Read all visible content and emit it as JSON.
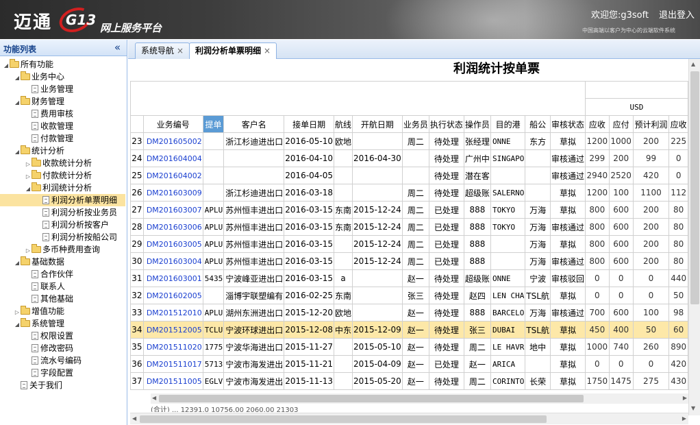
{
  "header": {
    "logo_text": "迈通",
    "logo_badge": "G13",
    "platform": "网上服务平台",
    "welcome": "欢迎您:g3soft",
    "logout": "退出登入",
    "slogan": "中国高端以客户为中心的云端软件系统"
  },
  "sidebar": {
    "title": "功能列表",
    "collapse_icon": "«",
    "items": [
      {
        "label": "所有功能",
        "level": 0,
        "type": "folder",
        "expanded": true
      },
      {
        "label": "业务中心",
        "level": 1,
        "type": "folder",
        "expanded": true
      },
      {
        "label": "业务管理",
        "level": 2,
        "type": "doc"
      },
      {
        "label": "财务管理",
        "level": 1,
        "type": "folder",
        "expanded": true
      },
      {
        "label": "费用审核",
        "level": 2,
        "type": "doc"
      },
      {
        "label": "收款管理",
        "level": 2,
        "type": "doc"
      },
      {
        "label": "付款管理",
        "level": 2,
        "type": "doc"
      },
      {
        "label": "统计分析",
        "level": 1,
        "type": "folder",
        "expanded": true
      },
      {
        "label": "收款统计分析",
        "level": 2,
        "type": "folder",
        "expanded": false
      },
      {
        "label": "付款统计分析",
        "level": 2,
        "type": "folder",
        "expanded": false
      },
      {
        "label": "利润统计分析",
        "level": 2,
        "type": "folder",
        "expanded": true
      },
      {
        "label": "利润分析单票明细",
        "level": 3,
        "type": "doc",
        "selected": true
      },
      {
        "label": "利润分析按业务员",
        "level": 3,
        "type": "doc"
      },
      {
        "label": "利润分析按客户",
        "level": 3,
        "type": "doc"
      },
      {
        "label": "利润分析按船公司",
        "level": 3,
        "type": "doc"
      },
      {
        "label": "多币种费用查询",
        "level": 2,
        "type": "folder",
        "expanded": false
      },
      {
        "label": "基础数据",
        "level": 1,
        "type": "folder",
        "expanded": true
      },
      {
        "label": "合作伙伴",
        "level": 2,
        "type": "doc"
      },
      {
        "label": "联系人",
        "level": 2,
        "type": "doc"
      },
      {
        "label": "其他基础",
        "level": 2,
        "type": "doc"
      },
      {
        "label": "增值功能",
        "level": 1,
        "type": "folder",
        "expanded": false
      },
      {
        "label": "系统管理",
        "level": 1,
        "type": "folder",
        "expanded": true
      },
      {
        "label": "权限设置",
        "level": 2,
        "type": "doc"
      },
      {
        "label": "修改密码",
        "level": 2,
        "type": "doc"
      },
      {
        "label": "流水号编码",
        "level": 2,
        "type": "doc"
      },
      {
        "label": "字段配置",
        "level": 2,
        "type": "doc"
      },
      {
        "label": "关于我们",
        "level": 1,
        "type": "doc"
      }
    ]
  },
  "tabs": [
    {
      "label": "系统导航",
      "close": "×",
      "active": false
    },
    {
      "label": "利润分析单票明细",
      "close": "×",
      "active": true
    }
  ],
  "report": {
    "title": "利润统计按单票",
    "currency": "USD",
    "columns": [
      "",
      "业务编号",
      "提单",
      "客户名",
      "接单日期",
      "航线",
      "开航日期",
      "业务员",
      "执行状态",
      "操作员",
      "目的港",
      "船公",
      "审核状态",
      "应收",
      "应付",
      "预计利润",
      "应收"
    ],
    "rows": [
      [
        "23",
        "DM201605002",
        "",
        "浙江杉迪进出口",
        "2016-05-10",
        "欧地",
        "",
        "周二",
        "待处理",
        "张经理",
        "ONNE",
        "东方",
        "草拟",
        "1200",
        "1000",
        "200",
        "225"
      ],
      [
        "24",
        "DM201604004",
        "",
        "",
        "2016-04-10",
        "",
        "2016-04-30",
        "",
        "待处理",
        "广州中",
        "SINGAPO",
        "",
        "审核通过",
        "299",
        "200",
        "99",
        "0"
      ],
      [
        "25",
        "DM201604002",
        "",
        "",
        "2016-04-05",
        "",
        "",
        "",
        "待处理",
        "潜在客",
        "",
        "",
        "审核通过",
        "2940",
        "2520",
        "420",
        "0"
      ],
      [
        "26",
        "DM201603009",
        "",
        "浙江杉迪进出口",
        "2016-03-18",
        "",
        "",
        "周二",
        "待处理",
        "超级账",
        "SALERNO",
        "",
        "草拟",
        "1200",
        "100",
        "1100",
        "112"
      ],
      [
        "27",
        "DM201603007",
        "APLU",
        "苏州恒丰进出口",
        "2016-03-15",
        "东南",
        "2015-12-24",
        "周二",
        "已处理",
        "888",
        "TOKYO",
        "万海",
        "草拟",
        "800",
        "600",
        "200",
        "80"
      ],
      [
        "28",
        "DM201603006",
        "APLU",
        "苏州恒丰进出口",
        "2016-03-15",
        "东南",
        "2015-12-24",
        "周二",
        "已处理",
        "888",
        "TOKYO",
        "万海",
        "审核通过",
        "800",
        "600",
        "200",
        "80"
      ],
      [
        "29",
        "DM201603005",
        "APLU",
        "苏州恒丰进出口",
        "2016-03-15",
        "",
        "2015-12-24",
        "周二",
        "已处理",
        "888",
        "",
        "万海",
        "草拟",
        "800",
        "600",
        "200",
        "80"
      ],
      [
        "30",
        "DM201603004",
        "APLU",
        "苏州恒丰进出口",
        "2016-03-15",
        "",
        "2015-12-24",
        "周二",
        "已处理",
        "888",
        "",
        "万海",
        "审核通过",
        "800",
        "600",
        "200",
        "80"
      ],
      [
        "31",
        "DM201603001",
        "5435",
        "宁波峰亚进出口",
        "2016-03-15",
        "a",
        "",
        "赵一",
        "待处理",
        "超级账",
        "ONNE",
        "宁波",
        "审核驳回",
        "0",
        "0",
        "0",
        "440"
      ],
      [
        "32",
        "DM201602005",
        "",
        "淄博宇联塑编有",
        "2016-02-25",
        "东南",
        "",
        "张三",
        "待处理",
        "赵四",
        "LEN CHA",
        "TSL航",
        "草拟",
        "0",
        "0",
        "0",
        "50"
      ],
      [
        "33",
        "DM201512010",
        "APLU",
        "湖州东洲进出口",
        "2015-12-20",
        "欧地",
        "",
        "赵一",
        "待处理",
        "888",
        "BARCELO",
        "万海",
        "审核通过",
        "700",
        "600",
        "100",
        "98"
      ],
      [
        "34",
        "DM201512005",
        "TCLU",
        "宁波环球进出口",
        "2015-12-08",
        "中东",
        "2015-12-09",
        "赵一",
        "待处理",
        "张三",
        "DUBAI",
        "TSL航",
        "草拟",
        "450",
        "400",
        "50",
        "60"
      ],
      [
        "35",
        "DM201511020",
        "1775",
        "宁波华海进出口",
        "2015-11-27",
        "",
        "2015-05-10",
        "赵一",
        "待处理",
        "周二",
        "LE HAVR",
        "地中",
        "草拟",
        "1000",
        "740",
        "260",
        "890"
      ],
      [
        "36",
        "DM201511017",
        "5713",
        "宁波市海发进出",
        "2015-11-21",
        "",
        "2015-04-09",
        "赵一",
        "已处理",
        "赵一",
        "ARICA",
        "",
        "草拟",
        "0",
        "0",
        "0",
        "420"
      ],
      [
        "37",
        "DM201511005",
        "EGLV",
        "宁波市海发进出",
        "2015-11-13",
        "",
        "2015-05-20",
        "赵一",
        "待处理",
        "周二",
        "CORINTO",
        "长荣",
        "草拟",
        "1750",
        "1475",
        "275",
        "430"
      ]
    ],
    "selected_row": "34",
    "totals_partial": "(合计)   ...   12391.0 10756.00   2060.00   21303"
  },
  "colors": {
    "selected_row": "#fde8a8",
    "link": "#1a3fd0",
    "tree_selected": "#fbe3a0",
    "border": "#99bbe8"
  }
}
